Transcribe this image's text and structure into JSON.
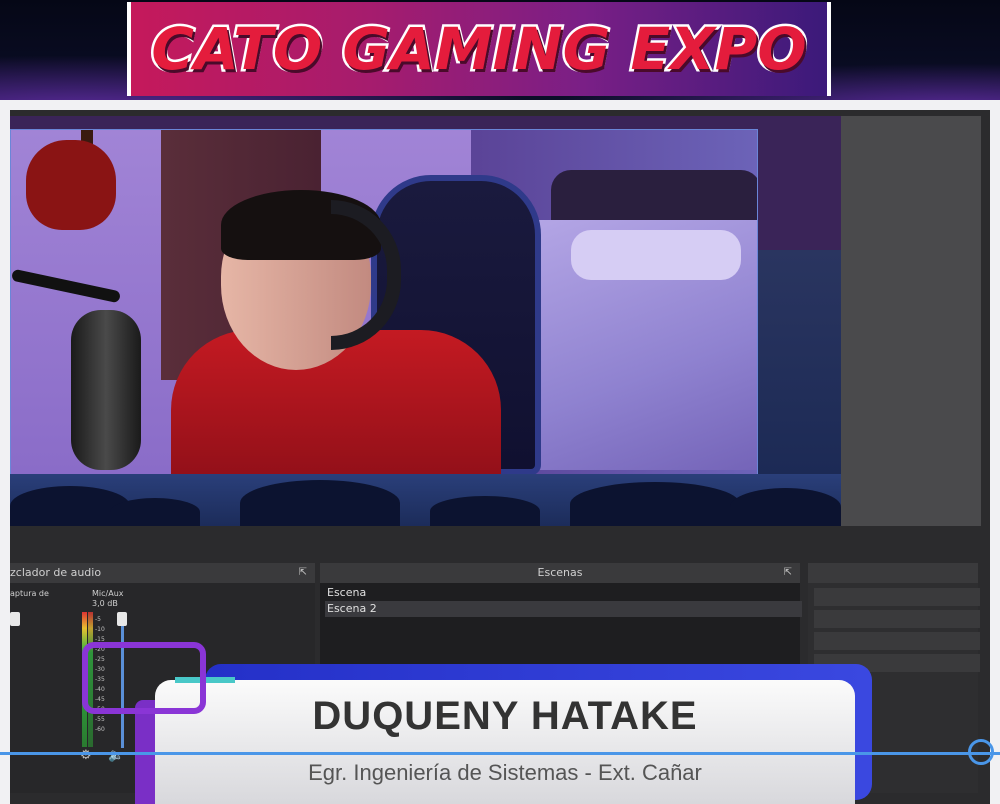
{
  "banner": {
    "title": "CATO GAMING EXPO"
  },
  "mixer": {
    "title": "zclador de audio",
    "channels": [
      {
        "label": "aptura de"
      },
      {
        "label": "Mic/Aux",
        "level": "3,0 dB"
      }
    ],
    "ticks": [
      "-5",
      "-10",
      "-15",
      "-20",
      "-25",
      "-30",
      "-35",
      "-40",
      "-45",
      "-50",
      "-55",
      "-60"
    ]
  },
  "scenes": {
    "title": "Escenas",
    "items": [
      "Escena",
      "Escena 2"
    ],
    "selected": "Escena 2"
  },
  "lower_third": {
    "name": "DUQUENY HATAKE",
    "subtitle": "Egr. Ingeniería de Sistemas - Ext. Cañar"
  },
  "colors": {
    "banner_start": "#c5195b",
    "banner_end": "#3b1a7a",
    "lower_third_blue": "#2430c8",
    "accent_purple": "#8a35d6",
    "line_blue": "#4a96e8"
  }
}
